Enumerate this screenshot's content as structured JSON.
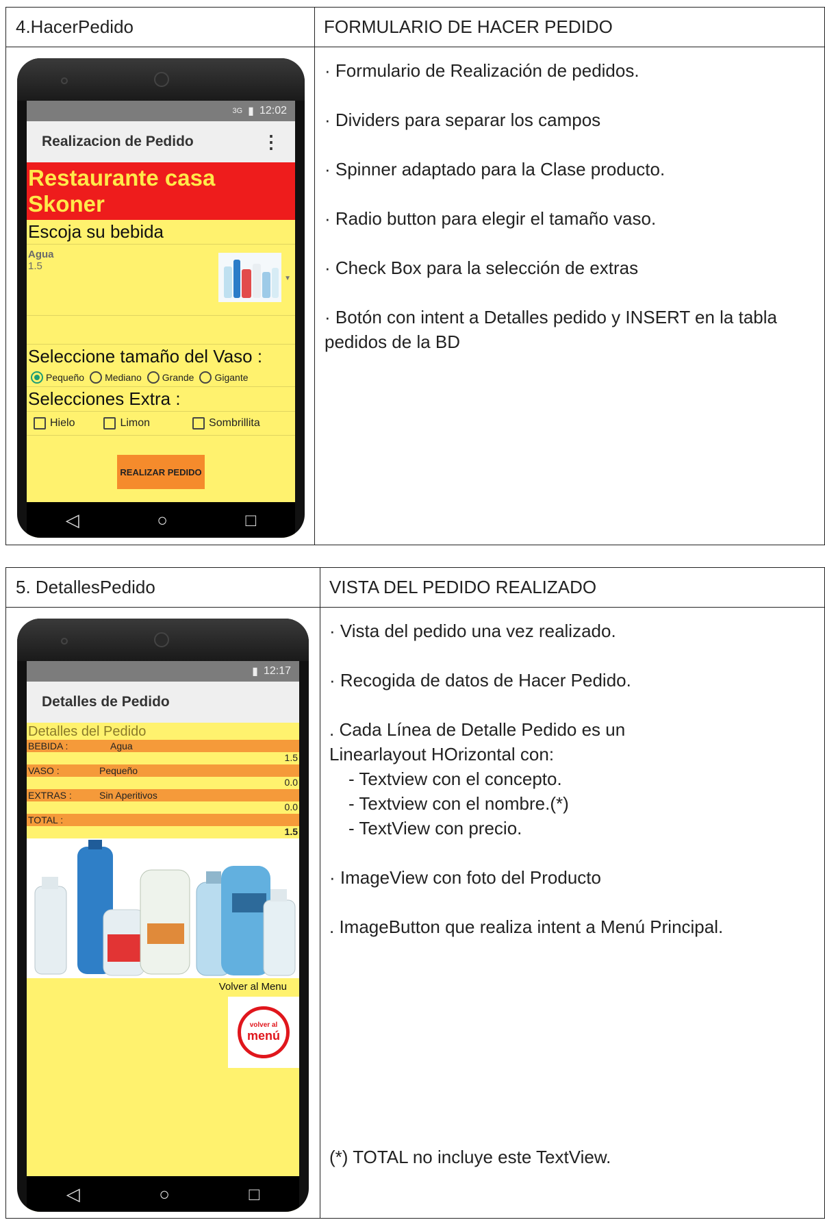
{
  "table1": {
    "left_header": "4.HacerPedido",
    "right_header": "FORMULARIO DE HACER PEDIDO",
    "bullets": [
      "· Formulario de Realización de pedidos.",
      "· Dividers para separar los campos",
      "· Spinner adaptado para la Clase producto.",
      "· Radio button para elegir el tamaño vaso.",
      "· Check Box para la selección de extras",
      "· Botón con intent a Detalles pedido y INSERT en la tabla pedidos de la BD"
    ],
    "phone": {
      "time": "12:02",
      "signal": "3G",
      "appbar_title": "Realizacion de Pedido",
      "menu_icon": "⋮",
      "restaurant": "Restaurante casa Skoner",
      "choose_drink": "Escoja su bebida",
      "drink_name": "Agua",
      "drink_price": "1.5",
      "size_title": "Seleccione tamaño del Vaso :",
      "sizes": [
        "Pequeño",
        "Mediano",
        "Grande",
        "Gigante"
      ],
      "selected_size": "Pequeño",
      "extras_title": "Selecciones Extra :",
      "extras": [
        "Hielo",
        "Limon",
        "Sombrillita"
      ],
      "submit": "REALIZAR PEDIDO"
    }
  },
  "table2": {
    "left_header": "5. DetallesPedido",
    "right_header": "VISTA DEL PEDIDO REALIZADO",
    "bullet1": "· Vista del pedido una vez realizado.",
    "bullet2": "· Recogida de datos de Hacer Pedido.",
    "bullet3a": ". Cada Línea de Detalle Pedido es un",
    "bullet3b": "Linearlayout HOrizontal con:",
    "sub1": "- Textview con el concepto.",
    "sub2": "- Textview con el nombre.(*)",
    "sub3": "- TextView con precio.",
    "bullet4": "· ImageView con foto del Producto",
    "bullet5": ". ImageButton que realiza intent a Menú Principal.",
    "footnote": "(*) TOTAL no incluye este TextView.",
    "phone": {
      "time": "12:17",
      "appbar_title": "Detalles de Pedido",
      "details_title": "Detalles del Pedido",
      "rows": [
        {
          "concept": "BEBIDA :",
          "name": "Agua",
          "price": "1.5"
        },
        {
          "concept": "VASO :",
          "name": "Pequeño",
          "price": "0.0"
        },
        {
          "concept": "EXTRAS :",
          "name": "Sin Aperitivos",
          "price": "0.0"
        },
        {
          "concept": "TOTAL :",
          "name": "",
          "price": "1.5"
        }
      ],
      "back_label": "Volver al Menu",
      "back_logo_top": "volver al",
      "back_logo_main": "menú"
    }
  }
}
